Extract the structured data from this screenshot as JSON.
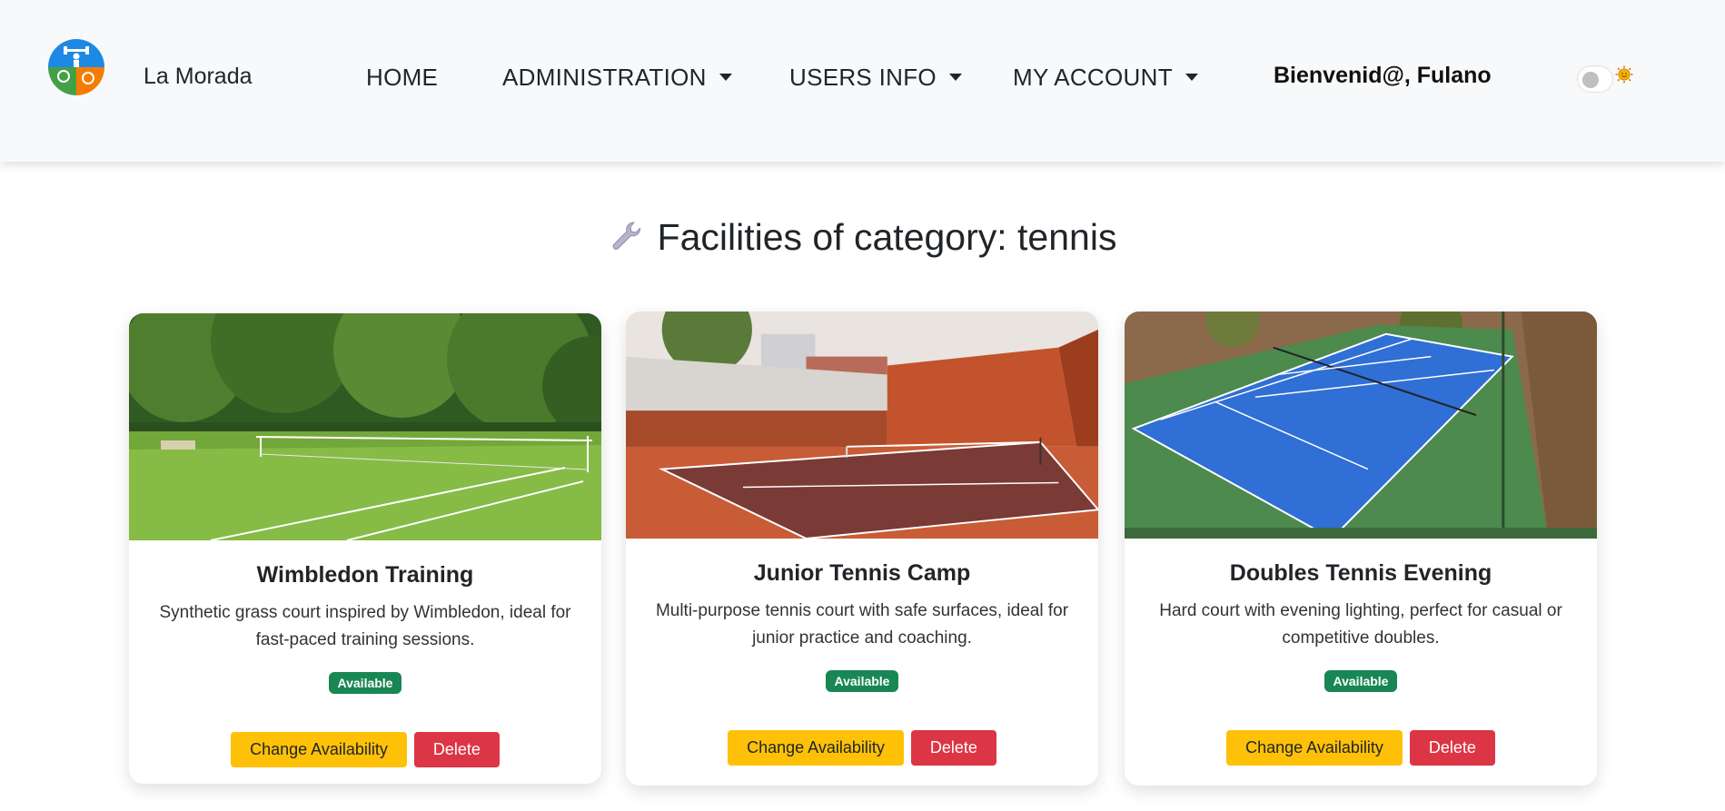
{
  "navbar": {
    "brand": "La Morada",
    "items": [
      {
        "label": "HOME",
        "dropdown": false
      },
      {
        "label": "ADMINISTRATION",
        "dropdown": true
      },
      {
        "label": "USERS INFO",
        "dropdown": true
      },
      {
        "label": "MY ACCOUNT",
        "dropdown": true
      }
    ],
    "welcome": "Bienvenid@, Fulano",
    "theme_toggle_icon": "sun-icon"
  },
  "page": {
    "title": "Facilities of category: tennis",
    "title_icon": "wrench-icon"
  },
  "facilities": [
    {
      "name": "Wimbledon Training",
      "description": "Synthetic grass court inspired by Wimbledon, ideal for fast-paced training sessions.",
      "status": "Available",
      "change_label": "Change Availability",
      "delete_label": "Delete"
    },
    {
      "name": "Junior Tennis Camp",
      "description": "Multi-purpose tennis court with safe surfaces, ideal for junior practice and coaching.",
      "status": "Available",
      "change_label": "Change Availability",
      "delete_label": "Delete"
    },
    {
      "name": "Doubles Tennis Evening",
      "description": "Hard court with evening lighting, perfect for casual or competitive doubles.",
      "status": "Available",
      "change_label": "Change Availability",
      "delete_label": "Delete"
    }
  ],
  "colors": {
    "navbar_bg": "#f8f9fa",
    "success": "#198754",
    "warning": "#ffc107",
    "danger": "#dc3545"
  }
}
